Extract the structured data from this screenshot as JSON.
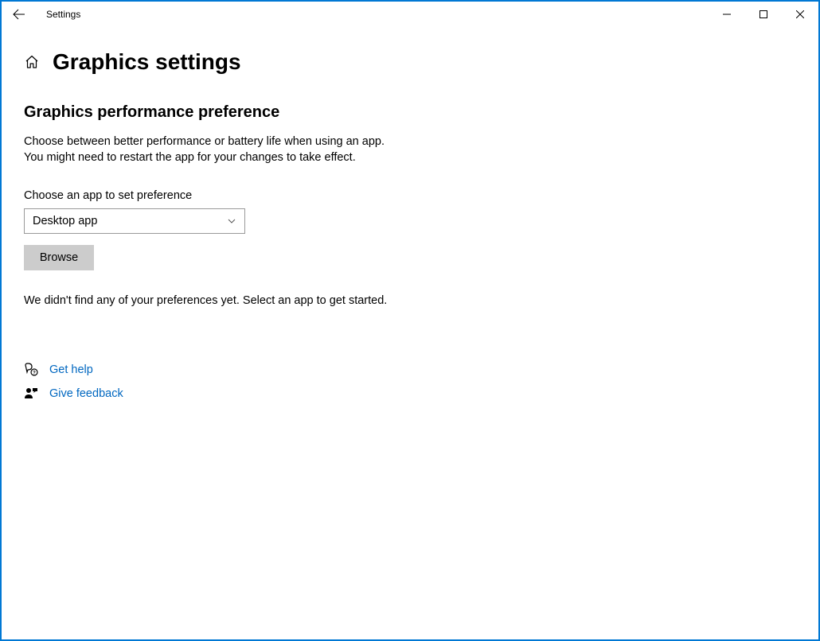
{
  "titlebar": {
    "title": "Settings"
  },
  "page": {
    "title": "Graphics settings"
  },
  "section": {
    "heading": "Graphics performance preference",
    "description_line1": "Choose between better performance or battery life when using an app.",
    "description_line2": "You might need to restart the app for your changes to take effect.",
    "field_label": "Choose an app to set preference",
    "dropdown_value": "Desktop app",
    "browse_label": "Browse",
    "status_text": "We didn't find any of your preferences yet. Select an app to get started."
  },
  "links": {
    "help": "Get help",
    "feedback": "Give feedback"
  }
}
